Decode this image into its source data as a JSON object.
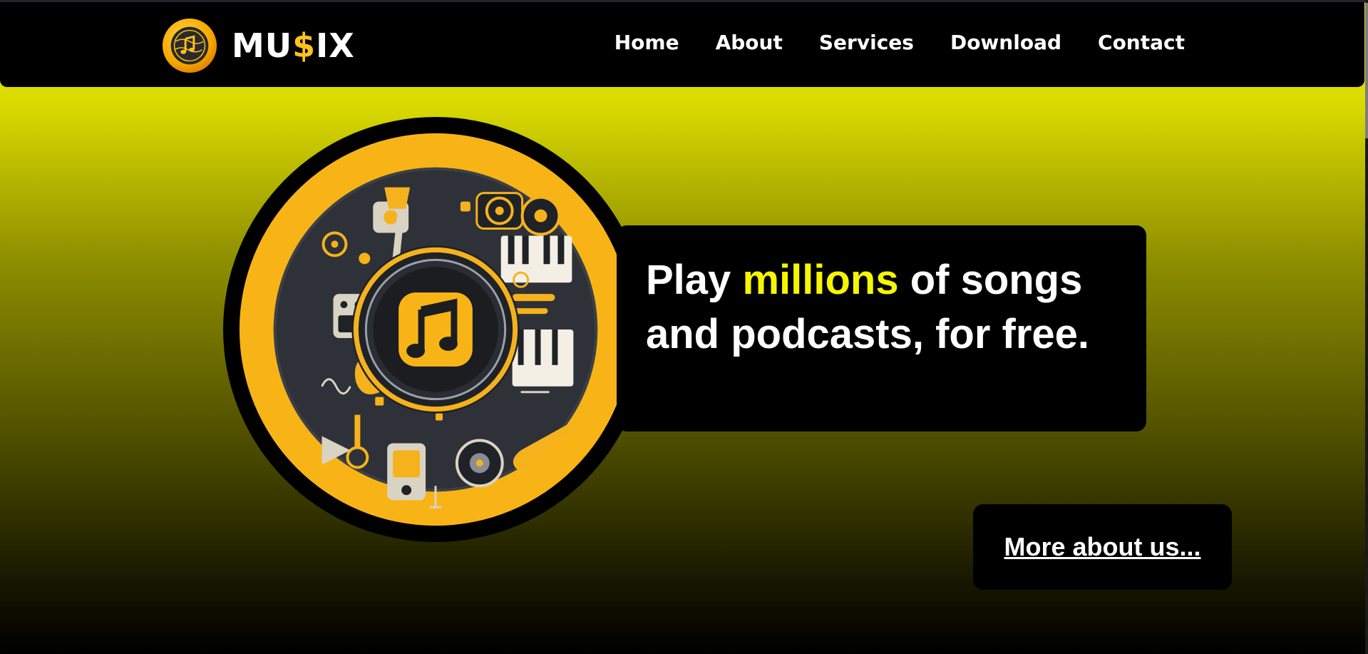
{
  "brand": {
    "name_prefix": "MU",
    "name_dollar": "$",
    "name_suffix": "IX",
    "logo_icon": "music-disc-logo-icon",
    "accent_color": "#ffc21a"
  },
  "nav": {
    "items": [
      {
        "label": "Home"
      },
      {
        "label": "About"
      },
      {
        "label": "Services"
      },
      {
        "label": "Download"
      },
      {
        "label": "Contact"
      }
    ]
  },
  "hero": {
    "image_icon": "music-instruments-disc-illustration",
    "headline": {
      "part1": "Play ",
      "highlight": "millions",
      "part2": " of songs and podcasts, for free."
    },
    "highlight_color": "#f6f600",
    "cta_label": "More about us..."
  },
  "theme": {
    "background_top": "#e3e300",
    "background_bottom": "#000000",
    "panel_color": "#000000"
  }
}
